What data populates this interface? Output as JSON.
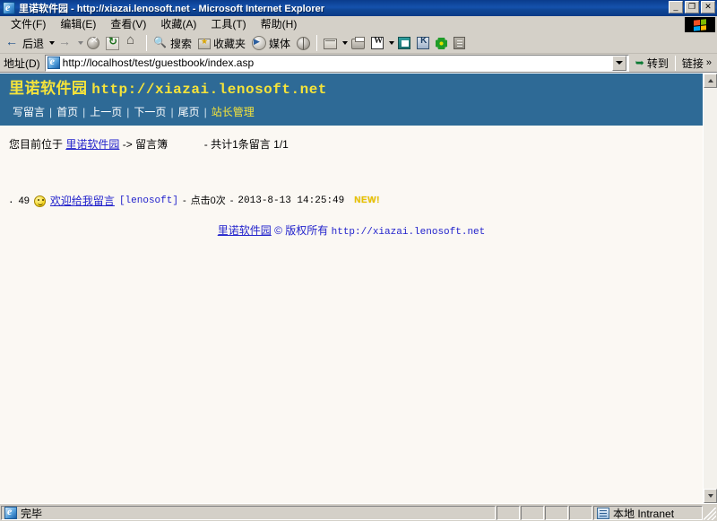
{
  "window": {
    "title": "里诺软件园 - http://xiazai.lenosoft.net - Microsoft Internet Explorer",
    "minimize_label": "_",
    "restore_label": "❐",
    "close_label": "✕"
  },
  "menu": {
    "items": [
      {
        "label": "文件(F)"
      },
      {
        "label": "编辑(E)"
      },
      {
        "label": "查看(V)"
      },
      {
        "label": "收藏(A)"
      },
      {
        "label": "工具(T)"
      },
      {
        "label": "帮助(H)"
      }
    ]
  },
  "toolbar": {
    "back_label": "后退",
    "forward_label": "",
    "stop_label": "",
    "refresh_label": "",
    "home_label": "",
    "search_label": "搜索",
    "favorites_label": "收藏夹",
    "media_label": "媒体",
    "history_label": "",
    "mail_label": "",
    "print_label": "",
    "edit_word_label": "",
    "discuss_label": "",
    "messenger_label": "",
    "plugin_label": "",
    "extra_label": ""
  },
  "address": {
    "label": "地址(D)",
    "url": "http://localhost/test/guestbook/index.asp",
    "go_label": "转到",
    "links_label": "链接",
    "links_chevron": "»"
  },
  "page": {
    "header": {
      "site_name": "里诺软件园",
      "site_url": "http://xiazai.lenosoft.net",
      "nav": [
        {
          "label": "写留言",
          "accent": false
        },
        {
          "label": "首页",
          "accent": false
        },
        {
          "label": "上一页",
          "accent": false
        },
        {
          "label": "下一页",
          "accent": false
        },
        {
          "label": "尾页",
          "accent": false
        },
        {
          "label": "站长管理",
          "accent": true
        }
      ],
      "nav_separator": "|"
    },
    "breadcrumb": {
      "prefix": "您目前位于",
      "site_link": "里诺软件园",
      "arrow": "->",
      "section": "留言簿",
      "count_text": "- 共计1条留言",
      "page_indicator": "1/1"
    },
    "entries": [
      {
        "bullet": "·",
        "number": "49",
        "icon": "smiley-icon",
        "title": "欢迎给我留言",
        "author": "[lenosoft]",
        "dash1": "-",
        "hits": "点击0次",
        "dash2": "-",
        "datetime": "2013-8-13 14:25:49",
        "badge": "NEW!"
      }
    ],
    "footer": {
      "site_link": "里诺软件园",
      "copyright": "© 版权所有",
      "url": "http://xiazai.lenosoft.net"
    }
  },
  "statusbar": {
    "status_text": "完毕",
    "zone_text": "本地 Intranet"
  },
  "colors": {
    "titlebar_blue": "#0f4697",
    "page_header_blue": "#2e6a96",
    "accent_yellow": "#f5e33a",
    "link_blue": "#2222cc",
    "chrome_gray": "#d4d0c8",
    "page_bg": "#fbf8f3",
    "badge_yellow": "#e8c200"
  }
}
